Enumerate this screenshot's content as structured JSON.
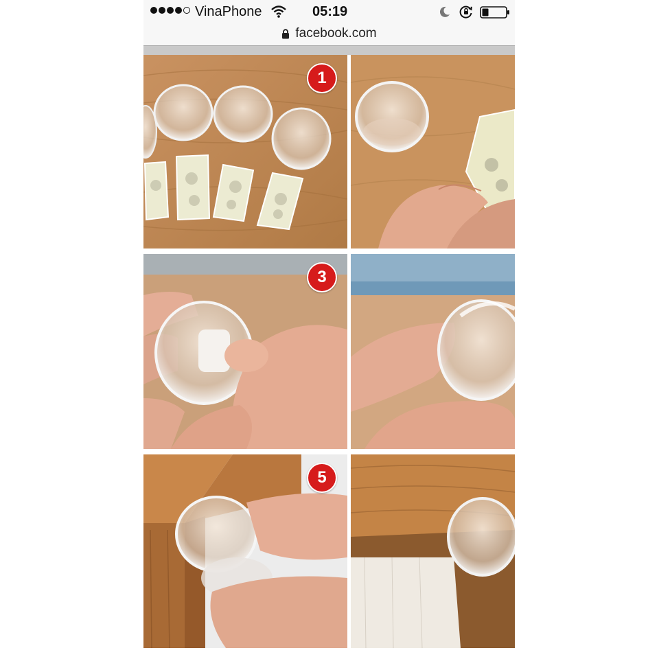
{
  "status_bar": {
    "carrier": "VinaPhone",
    "time": "05:19",
    "signal_bars": 4,
    "signal_total": 5
  },
  "address_bar": {
    "url": "facebook.com"
  },
  "photo": {
    "steps": [
      {
        "number": "1"
      },
      {
        "number": "3"
      },
      {
        "number": "5"
      }
    ]
  },
  "colors": {
    "badge_red": "#d61b1b",
    "wood": "#c08a4e",
    "skin": "#e8b49a"
  }
}
